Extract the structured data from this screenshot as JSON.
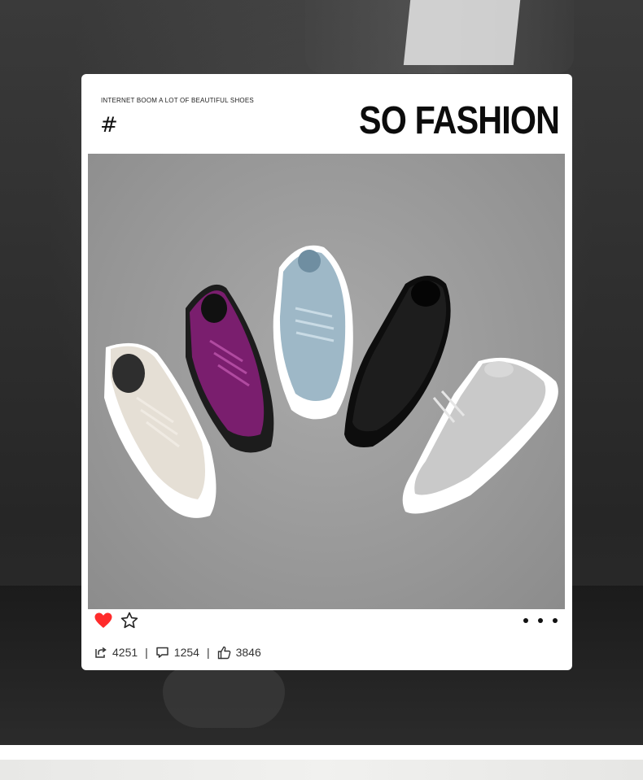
{
  "post": {
    "tagline": "INTERNET BOOM A LOT OF BEAUTIFUL SHOES",
    "hash": "#",
    "headline": "SO FASHION",
    "shoes": [
      "beige-sneaker",
      "purple-sneaker",
      "light-blue-sneaker",
      "black-sneaker",
      "grey-sneaker"
    ]
  },
  "actions": {
    "like_icon": "heart-icon",
    "favorite_icon": "star-icon",
    "more_icon": "more-dots-icon"
  },
  "stats": {
    "shares": "4251",
    "comments": "1254",
    "likes": "3846",
    "separator": "|"
  },
  "colors": {
    "heart": "#ff2b2b",
    "card": "#ffffff",
    "photo_bg": "#9a9a9a"
  }
}
